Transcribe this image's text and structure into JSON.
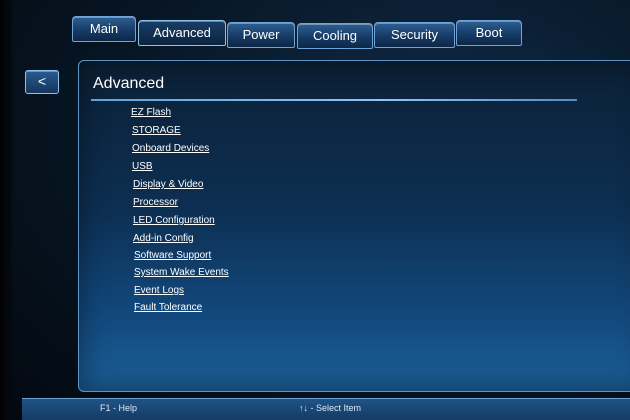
{
  "tabs": [
    {
      "label": "Main"
    },
    {
      "label": "Advanced"
    },
    {
      "label": "Power"
    },
    {
      "label": "Cooling"
    },
    {
      "label": "Security"
    },
    {
      "label": "Boot"
    }
  ],
  "active_tab": "Advanced",
  "back_button": {
    "label": "<"
  },
  "panel": {
    "title": "Advanced",
    "items": [
      {
        "label": "EZ Flash"
      },
      {
        "label": "STORAGE"
      },
      {
        "label": "Onboard Devices"
      },
      {
        "label": "USB"
      },
      {
        "label": "Display & Video"
      },
      {
        "label": "Processor"
      },
      {
        "label": "LED Configuration"
      },
      {
        "label": "Add-in Config"
      },
      {
        "label": "Software Support"
      },
      {
        "label": "System Wake Events"
      },
      {
        "label": "Event Logs"
      },
      {
        "label": "Fault Tolerance"
      }
    ]
  },
  "status_bar": {
    "help": "F1 - Help",
    "select": "↑↓ - Select Item"
  },
  "colors": {
    "tab_border": "#6fa3d3",
    "panel_border": "#5f93c4",
    "accent_line": "#8cc7f2",
    "text": "#ffffff"
  }
}
